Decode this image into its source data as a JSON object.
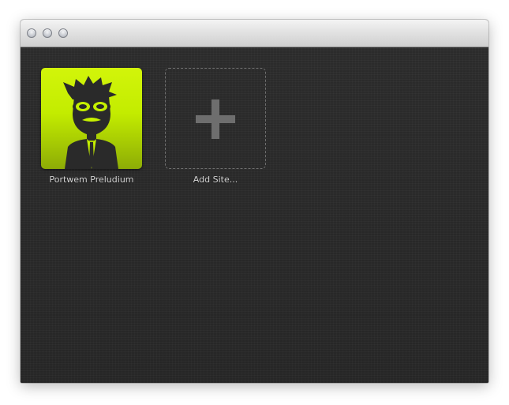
{
  "window": {
    "controls": [
      "close",
      "minimize",
      "zoom"
    ]
  },
  "sites": [
    {
      "label": "Portwem Preludium",
      "icon": "hipster-avatar-icon",
      "color": "#c6f000"
    }
  ],
  "add_site": {
    "label": "Add Site...",
    "icon": "plus-icon"
  },
  "colors": {
    "background": "#2b2b2b",
    "accent": "#c6f000",
    "label_text": "#d4d4d4",
    "dashed_border": "#6e6e6e"
  }
}
